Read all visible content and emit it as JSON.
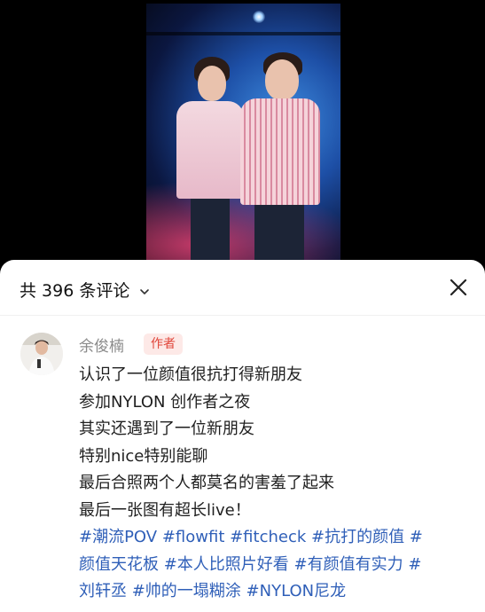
{
  "comments_sheet": {
    "count_label": "共 396 条评论",
    "comment": {
      "author": "余俊楠",
      "badge": "作者",
      "lines": [
        "认识了一位颜值很抗打得新朋友",
        "参加NYLON 创作者之夜",
        "其实还遇到了一位新朋友",
        "特别nice特别能聊",
        "最后合照两个人都莫名的害羞了起来",
        "最后一张图有超长live！"
      ],
      "hashtag_lines": [
        "#潮流POV #flowfit #fitcheck #抗打的颜值 #",
        "颜值天花板 #本人比照片好看 #有颜值有实力 #",
        "刘轩丞 #帅的一塌糊涂 #NYLON尼龙"
      ]
    }
  },
  "colors": {
    "hashtag": "#2f5fb8",
    "badge_bg": "#fde9e7",
    "badge_text": "#e0453a"
  }
}
